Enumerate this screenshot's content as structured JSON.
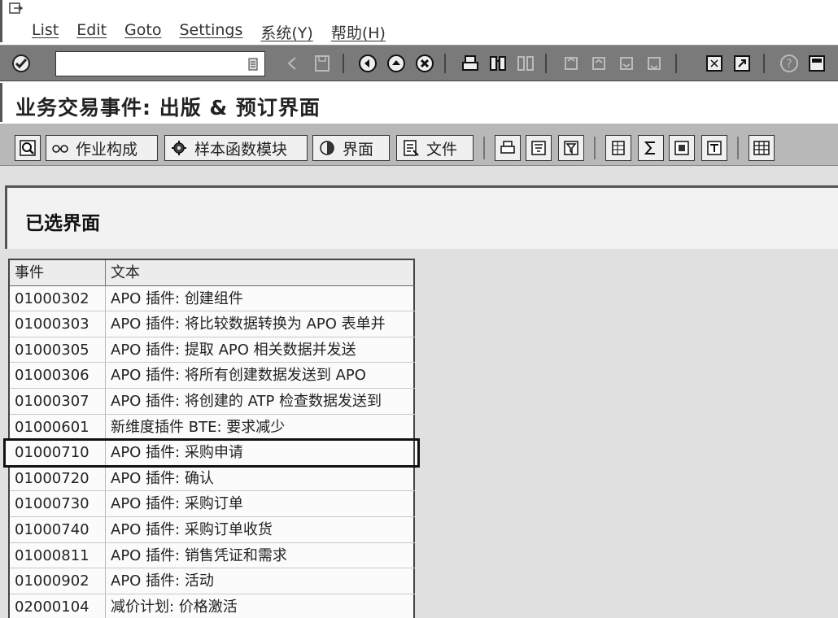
{
  "menubar": {
    "items": [
      "List",
      "Edit",
      "Goto",
      "Settings",
      "系统(Y)",
      "帮助(H)"
    ]
  },
  "toolbar": {
    "command_field_value": ""
  },
  "titlebar": {
    "title": "业务交易事件: 出版 & 预订界面"
  },
  "apptoolbar": {
    "btn_structure": "作业构成",
    "btn_sample": "样本函数模块",
    "btn_interface": "界面",
    "btn_document": "文件"
  },
  "group": {
    "title": "已选界面"
  },
  "table": {
    "headers": {
      "event": "事件",
      "text": "文本"
    },
    "rows": [
      {
        "event": "01000302",
        "text": "APO 插件: 创建组件"
      },
      {
        "event": "01000303",
        "text": "APO 插件: 将比较数据转换为 APO 表单并"
      },
      {
        "event": "01000305",
        "text": "APO 插件: 提取 APO 相关数据并发送"
      },
      {
        "event": "01000306",
        "text": "APO 插件: 将所有创建数据发送到 APO"
      },
      {
        "event": "01000307",
        "text": "APO 插件: 将创建的 ATP 检查数据发送到"
      },
      {
        "event": "01000601",
        "text": "新维度插件 BTE: 要求减少"
      },
      {
        "event": "01000710",
        "text": "APO 插件: 采购申请"
      },
      {
        "event": "01000720",
        "text": "APO 插件: 确认"
      },
      {
        "event": "01000730",
        "text": "APO 插件: 采购订单"
      },
      {
        "event": "01000740",
        "text": "APO 插件: 采购订单收货"
      },
      {
        "event": "01000811",
        "text": "APO 插件: 销售凭证和需求"
      },
      {
        "event": "01000902",
        "text": "APO 插件: 活动"
      },
      {
        "event": "02000104",
        "text": "减价计划: 价格激活"
      }
    ],
    "selected_event": "01000710"
  }
}
